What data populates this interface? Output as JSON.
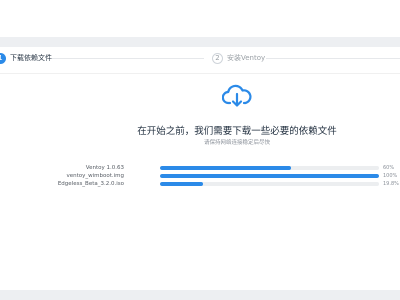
{
  "steps": [
    {
      "number": "1",
      "label": "下载依赖文件"
    },
    {
      "number": "2",
      "label": "安装Ventoy"
    }
  ],
  "icon": "cloud-download-icon",
  "accent_color": "#2b8ae8",
  "headline": "在开始之前，我们需要下载一些必要的依赖文件",
  "subline": "请保持网络连接稳定后尽快",
  "downloads": [
    {
      "name": "Ventoy 1.0.63",
      "progress": 0.6,
      "percent": "60%"
    },
    {
      "name": "ventoy_wimboot.img",
      "progress": 1.0,
      "percent": "100%"
    },
    {
      "name": "Edgeless_Beta_3.2.0.iso",
      "progress": 0.198,
      "percent": "19.8%"
    }
  ]
}
